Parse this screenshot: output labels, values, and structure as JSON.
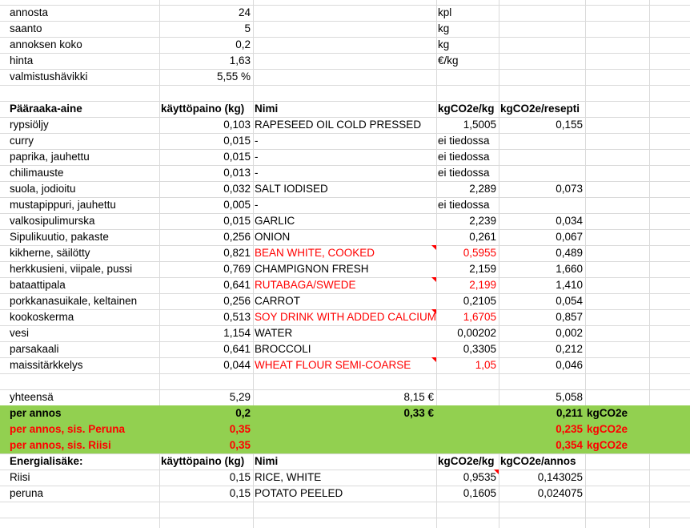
{
  "params": [
    {
      "label": "annosta",
      "value": "24",
      "unit": "kpl"
    },
    {
      "label": "saanto",
      "value": "5",
      "unit": "kg"
    },
    {
      "label": "annoksen koko",
      "value": "0,2",
      "unit": "kg"
    },
    {
      "label": "hinta",
      "value": "1,63",
      "unit": "€/kg"
    },
    {
      "label": "valmistushävikki",
      "value": "5,55 %",
      "unit": ""
    }
  ],
  "main_header": {
    "col_a": "Pääraaka-aine",
    "col_b": "käyttöpaino (kg)",
    "col_c": "Nimi",
    "col_d": "kgCO2e/kg",
    "col_e": "kgCO2e/resepti"
  },
  "ingredients": [
    {
      "name": "rypsiöljy",
      "weight": "0,103",
      "match": "RAPESEED OIL COLD PRESSED",
      "co2kg": "1,5005",
      "co2rec": "0,155",
      "red": false
    },
    {
      "name": "curry",
      "weight": "0,015",
      "match": "-",
      "co2kg": "ei tiedossa",
      "co2rec": "",
      "red": false
    },
    {
      "name": "paprika, jauhettu",
      "weight": "0,015",
      "match": "-",
      "co2kg": "ei tiedossa",
      "co2rec": "",
      "red": false
    },
    {
      "name": "chilimauste",
      "weight": "0,013",
      "match": "-",
      "co2kg": "ei tiedossa",
      "co2rec": "",
      "red": false
    },
    {
      "name": "suola, jodioitu",
      "weight": "0,032",
      "match": "SALT IODISED",
      "co2kg": "2,289",
      "co2rec": "0,073",
      "red": false
    },
    {
      "name": "mustapippuri, jauhettu",
      "weight": "0,005",
      "match": "-",
      "co2kg": "ei tiedossa",
      "co2rec": "",
      "red": false
    },
    {
      "name": "valkosipulimurska",
      "weight": "0,015",
      "match": "GARLIC",
      "co2kg": "2,239",
      "co2rec": "0,034",
      "red": false
    },
    {
      "name": "Sipulikuutio, pakaste",
      "weight": "0,256",
      "match": "ONION",
      "co2kg": "0,261",
      "co2rec": "0,067",
      "red": false
    },
    {
      "name": "kikherne, säilötty",
      "weight": "0,821",
      "match": "BEAN WHITE, COOKED",
      "co2kg": "0,5955",
      "co2rec": "0,489",
      "red": true
    },
    {
      "name": "herkkusieni, viipale, pussi",
      "weight": "0,769",
      "match": "CHAMPIGNON FRESH",
      "co2kg": "2,159",
      "co2rec": "1,660",
      "red": false
    },
    {
      "name": "bataattipala",
      "weight": "0,641",
      "match": "RUTABAGA/SWEDE",
      "co2kg": "2,199",
      "co2rec": "1,410",
      "red": true
    },
    {
      "name": "porkkanasuikale, keltainen",
      "weight": "0,256",
      "match": "CARROT",
      "co2kg": "0,2105",
      "co2rec": "0,054",
      "red": false
    },
    {
      "name": "kookoskerma",
      "weight": "0,513",
      "match": "SOY DRINK WITH ADDED CALCIUM",
      "co2kg": "1,6705",
      "co2rec": "0,857",
      "red": true
    },
    {
      "name": "vesi",
      "weight": "1,154",
      "match": "WATER",
      "co2kg": "0,00202",
      "co2rec": "0,002",
      "red": false
    },
    {
      "name": "parsakaali",
      "weight": "0,641",
      "match": "BROCCOLI",
      "co2kg": "0,3305",
      "co2rec": "0,212",
      "red": false
    },
    {
      "name": "maissitärkkelys",
      "weight": "0,044",
      "match": "WHEAT FLOUR SEMI-COARSE",
      "co2kg": "1,05",
      "co2rec": "0,046",
      "red": true
    }
  ],
  "total": {
    "label": "yhteensä",
    "weight": "5,29",
    "price": "8,15 €",
    "co2": "5,058"
  },
  "per_serving": [
    {
      "label": "per annos",
      "weight": "0,2",
      "price": "0,33 €",
      "co2": "0,211",
      "unit": "kgCO2e",
      "red": false
    },
    {
      "label": "per annos, sis. Peruna",
      "weight": "0,35",
      "price": "",
      "co2": "0,235",
      "unit": "kgCO2e",
      "red": true
    },
    {
      "label": "per annos, sis. Riisi",
      "weight": "0,35",
      "price": "",
      "co2": "0,354",
      "unit": "kgCO2e",
      "red": true
    }
  ],
  "energy_header": {
    "col_a": "Energialisäke:",
    "col_b": "käyttöpaino (kg)",
    "col_c": "Nimi",
    "col_d": "kgCO2e/kg",
    "col_e": "kgCO2e/annos"
  },
  "energy": [
    {
      "name": "Riisi",
      "weight": "0,15",
      "match": "RICE, WHITE",
      "co2kg": "0,9535",
      "co2serv": "0,143025"
    },
    {
      "name": "peruna",
      "weight": "0,15",
      "match": "POTATO PEELED",
      "co2kg": "0,1605",
      "co2serv": "0,024075"
    }
  ]
}
